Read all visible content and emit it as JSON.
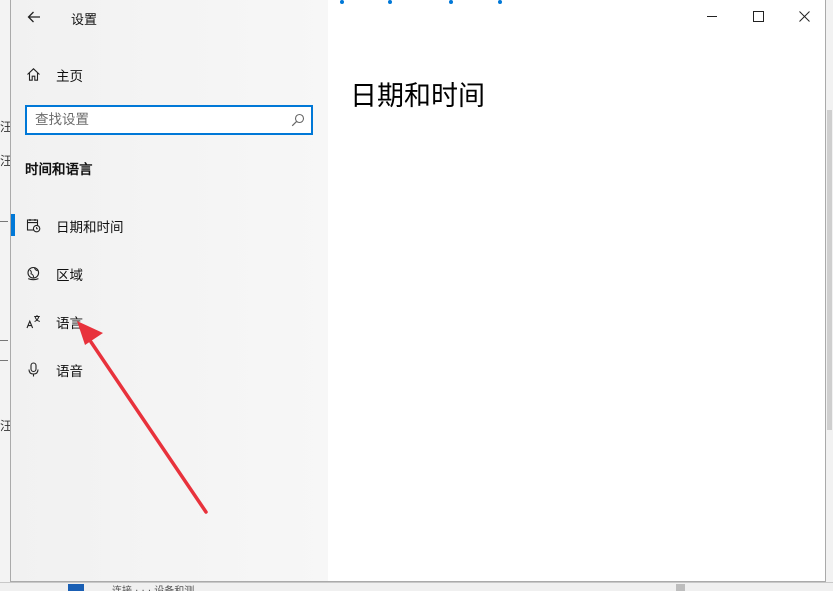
{
  "window": {
    "app_title": "设置",
    "controls": {
      "minimize_icon": "minimize-icon",
      "maximize_icon": "maximize-icon",
      "close_icon": "close-icon"
    }
  },
  "sidebar": {
    "home_label": "主页",
    "search_placeholder": "查找设置",
    "section_title": "时间和语言",
    "items": [
      {
        "label": "日期和时间",
        "icon": "calendar-clock-icon",
        "active": true
      },
      {
        "label": "区域",
        "icon": "globe-icon",
        "active": false
      },
      {
        "label": "语言",
        "icon": "language-icon",
        "active": false
      },
      {
        "label": "语音",
        "icon": "microphone-icon",
        "active": false
      }
    ]
  },
  "content": {
    "page_title": "日期和时间"
  },
  "background": {
    "left_fragments": [
      "汪",
      "汪"
    ],
    "bottom_text": "连接 · · · 设备和测"
  },
  "colors": {
    "accent": "#0078d7",
    "arrow": "#e8323c",
    "sidebar_bg": "#f3f3f3"
  }
}
